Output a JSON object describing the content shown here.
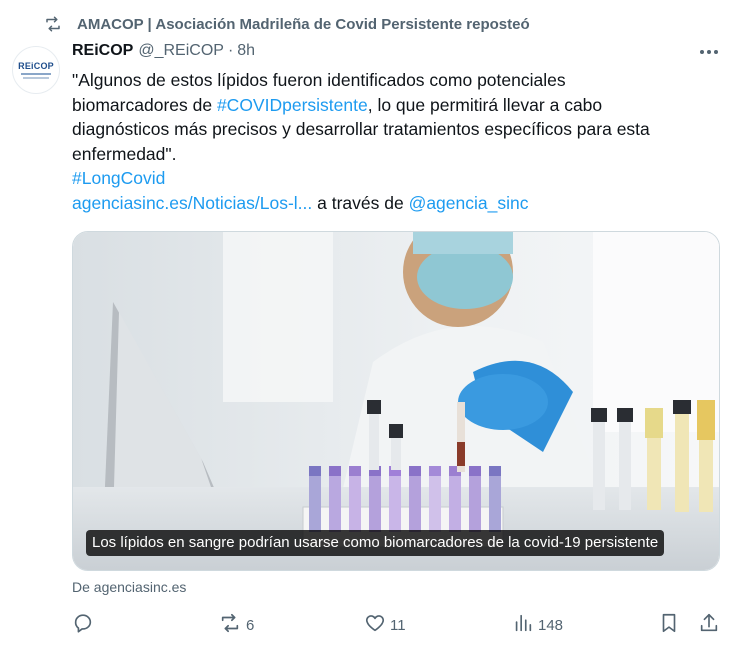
{
  "repost": {
    "text": "AMACOP | Asociación Madrileña de Covid Persistente reposteó",
    "icon": "repost-icon"
  },
  "author": {
    "avatar_text": "REiCOP",
    "name": "REiCOP",
    "handle": "@_REiCOP",
    "separator": "·",
    "time": "8h"
  },
  "tweet": {
    "l1": "\"Algunos de estos lípidos fueron identificados como potenciales",
    "l2_pre": "biomarcadores de ",
    "l2_hashtag": "#COVIDpersistente",
    "l2_post": ", lo que permitirá llevar a cabo",
    "l3": "diagnósticos más precisos y desarrollar tratamientos específicos para esta",
    "l4": "enfermedad\".",
    "hashtag2": "#LongCovid",
    "link": "agenciasinc.es/Noticias/Los-l...",
    "via": " a través de ",
    "mention": "@agencia_sinc"
  },
  "media": {
    "caption": "Los lípidos en sangre podrían usarse como biomarcadores de la covid-19 persistente",
    "source": "De agenciasinc.es"
  },
  "actions": {
    "reply_count": "",
    "repost_count": "6",
    "like_count": "11",
    "views_count": "148"
  },
  "colors": {
    "link": "#1d9bf0",
    "secondary": "#536471",
    "text": "#0f1419"
  }
}
